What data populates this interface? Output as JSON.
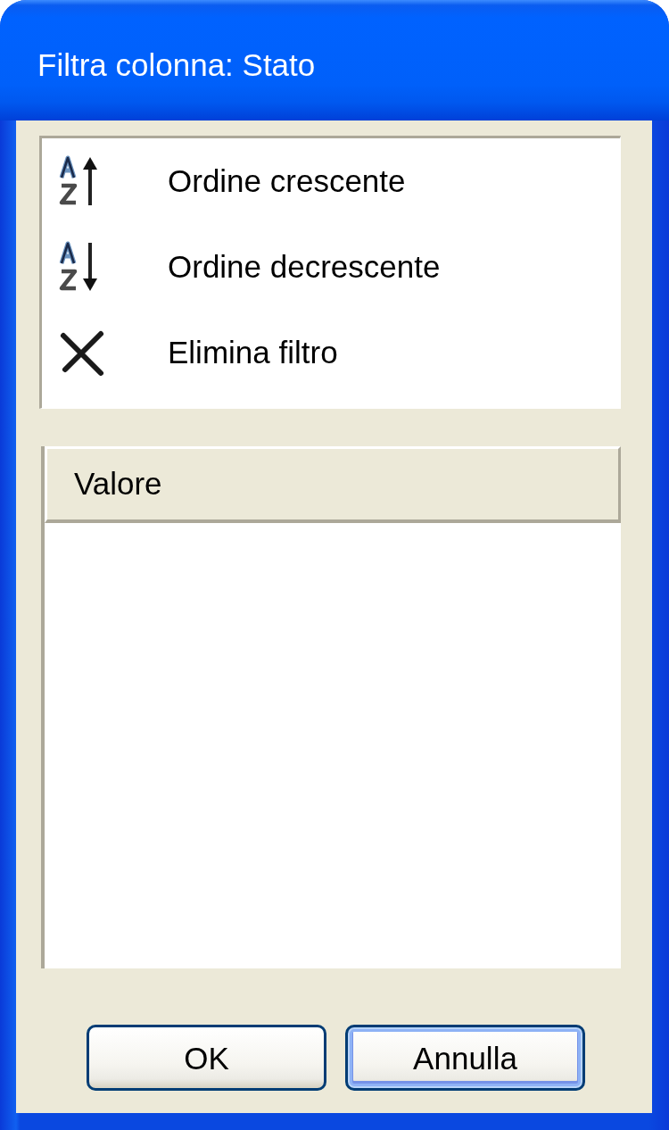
{
  "window": {
    "title": "Filtra colonna: Stato"
  },
  "menu": {
    "items": [
      {
        "kind": "sort_ascending",
        "label": "Ordine crescente"
      },
      {
        "kind": "sort_descending",
        "label": "Ordine decrescente"
      },
      {
        "kind": "clear_filter",
        "label": "Elimina filtro"
      }
    ]
  },
  "grid": {
    "columns": [
      {
        "label": "Valore"
      }
    ]
  },
  "buttons": [
    {
      "label": "OK",
      "focused": false
    },
    {
      "label": "Annulla",
      "focused": true
    }
  ]
}
